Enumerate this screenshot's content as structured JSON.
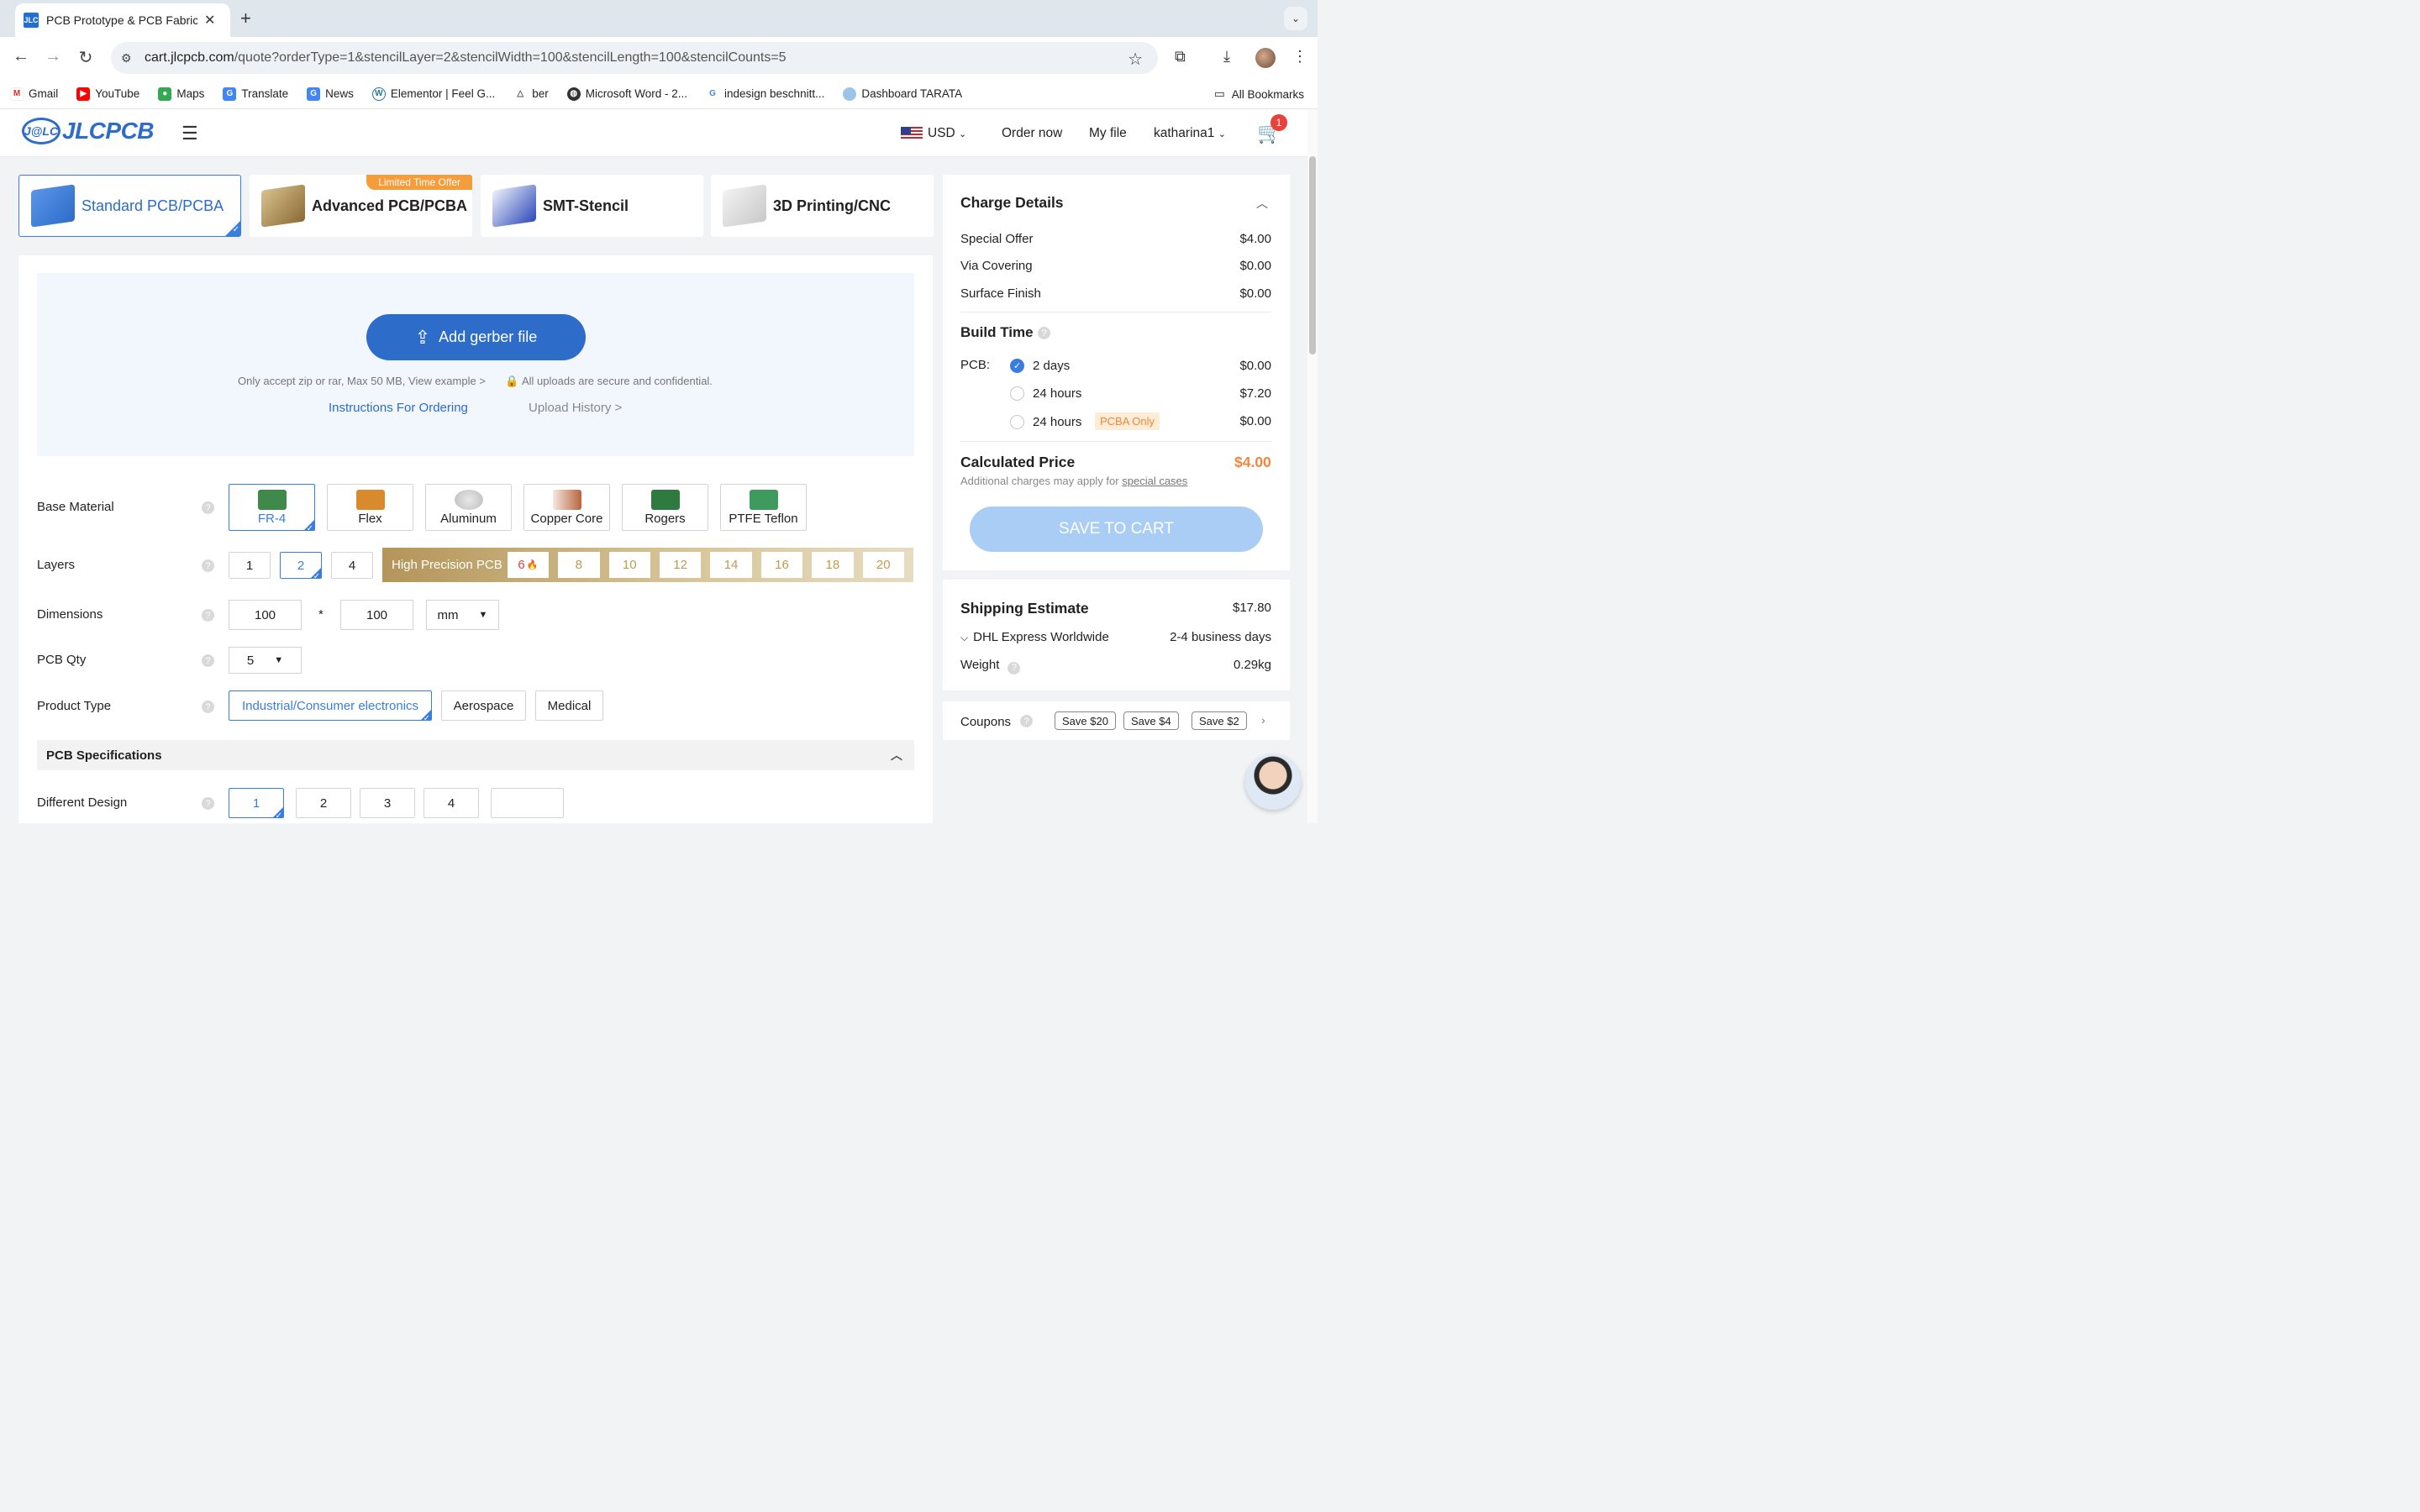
{
  "browser": {
    "tab_title": "PCB Prototype & PCB Fabrica",
    "favicon_text": "JLC",
    "url_host": "cart.jlcpcb.com",
    "url_path": "/quote?orderType=1&stencilLayer=2&stencilWidth=100&stencilLength=100&stencilCounts=5",
    "bookmarks": [
      "Gmail",
      "YouTube",
      "Maps",
      "Translate",
      "News",
      "Elementor | Feel G...",
      "ber",
      "Microsoft Word - 2...",
      "indesign beschnitt...",
      "Dashboard TARATA"
    ],
    "all_bookmarks": "All Bookmarks"
  },
  "header": {
    "logo_badge": "J@LC",
    "logo_text": "JLCPCB",
    "currency": "USD",
    "order_now": "Order now",
    "my_file": "My file",
    "user": "katharina1",
    "cart_count": "1"
  },
  "product_tabs": [
    {
      "label": "Standard PCB/PCBA"
    },
    {
      "label": "Advanced PCB/PCBA",
      "badge": "Limited Time Offer"
    },
    {
      "label": "SMT-Stencil"
    },
    {
      "label": "3D Printing/CNC"
    }
  ],
  "upload": {
    "button": "Add gerber file",
    "accept_note": "Only accept zip or rar, Max 50 MB, View example >",
    "secure_note": "All uploads are secure and confidential.",
    "instructions": "Instructions For Ordering",
    "history": "Upload History >"
  },
  "form": {
    "base_material": {
      "label": "Base Material",
      "options": [
        "FR-4",
        "Flex",
        "Aluminum",
        "Copper Core",
        "Rogers",
        "PTFE Teflon"
      ],
      "selected": "FR-4"
    },
    "layers": {
      "label": "Layers",
      "options": [
        "1",
        "2",
        "4"
      ],
      "selected": "2",
      "hp_title": "High Precision PCB",
      "hp_options": [
        "6",
        "8",
        "10",
        "12",
        "14",
        "16",
        "18",
        "20"
      ]
    },
    "dimensions": {
      "label": "Dimensions",
      "width": "100",
      "times": "*",
      "length": "100",
      "unit": "mm"
    },
    "qty": {
      "label": "PCB Qty",
      "value": "5"
    },
    "product_type": {
      "label": "Product Type",
      "options": [
        "Industrial/Consumer electronics",
        "Aerospace",
        "Medical"
      ],
      "selected": "Industrial/Consumer electronics"
    },
    "spec_header": "PCB Specifications",
    "different_design": {
      "label": "Different Design",
      "options": [
        "1",
        "2",
        "3",
        "4"
      ],
      "selected": "1"
    }
  },
  "charge": {
    "title": "Charge Details",
    "rows": [
      {
        "label": "Special Offer",
        "value": "$4.00"
      },
      {
        "label": "Via Covering",
        "value": "$0.00"
      },
      {
        "label": "Surface Finish",
        "value": "$0.00"
      }
    ],
    "build_time_title": "Build Time",
    "pcb_label": "PCB:",
    "build_options": [
      {
        "label": "2 days",
        "value": "$0.00",
        "selected": true
      },
      {
        "label": "24 hours",
        "value": "$7.20",
        "selected": false
      },
      {
        "label": "24 hours",
        "value": "$0.00",
        "selected": false,
        "tag": "PCBA Only"
      }
    ],
    "calculated_title": "Calculated Price",
    "calculated_value": "$4.00",
    "note_prefix": "Additional charges may apply for",
    "note_link": "special cases",
    "save_button": "SAVE TO CART"
  },
  "shipping": {
    "title": "Shipping Estimate",
    "price": "$17.80",
    "method": "DHL Express Worldwide",
    "days": "2-4 business days",
    "weight_label": "Weight",
    "weight": "0.29kg"
  },
  "coupons": {
    "label": "Coupons",
    "items": [
      "Save $20",
      "Save $4",
      "Save $2"
    ]
  },
  "colors": {
    "accent": "#2d6cc9",
    "price": "#f0873d",
    "gold": "#c29a4c"
  }
}
